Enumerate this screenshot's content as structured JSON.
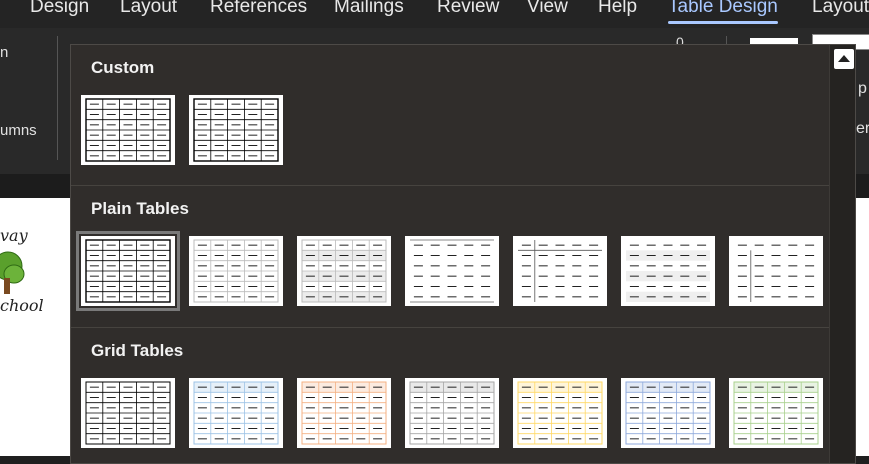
{
  "menubar": {
    "tabs": [
      "Design",
      "Layout",
      "References",
      "Mailings",
      "Review",
      "View",
      "Help",
      "Table Design",
      "Layout"
    ],
    "active_tab": "Table Design"
  },
  "ribbon": {
    "left_fragment_1": "n",
    "left_fragment_2": "umns",
    "zero_label": "0",
    "right_fragment_1": "p",
    "right_fragment_2": "er"
  },
  "document": {
    "text_top": "vay",
    "text_bottom": "chool"
  },
  "gallery": {
    "sections": [
      {
        "title": "Custom",
        "count": 2
      },
      {
        "title": "Plain Tables",
        "count": 7
      },
      {
        "title": "Grid Tables",
        "count": 7
      }
    ],
    "grid_accent_colors": [
      "#000000",
      "#9dc3e6",
      "#f4b183",
      "#a6a6a6",
      "#ffd966",
      "#8faadc",
      "#a9d18e"
    ]
  }
}
